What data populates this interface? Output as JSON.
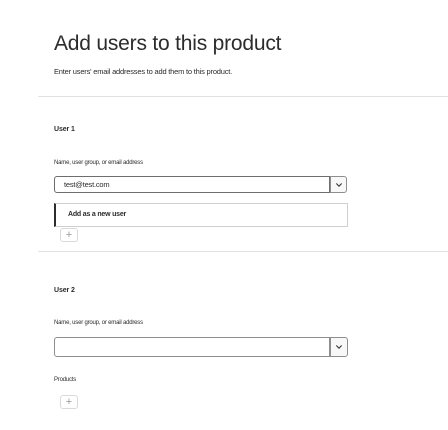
{
  "header": {
    "title": "Add users to this product",
    "subtitle": "Enter users' email addresses to add them to this product."
  },
  "user1": {
    "label": "User 1",
    "field_label": "Name, user group, or email address",
    "value": "test@test.com",
    "suggestion": "Add as a new user",
    "add_icon": "+"
  },
  "user2": {
    "label": "User 2",
    "field_label": "Name, user group, or email address",
    "value": "",
    "products_label": "Products",
    "add_icon": "+"
  },
  "icons": {
    "dropdown": "chevron-down-icon",
    "add": "plus-icon"
  }
}
